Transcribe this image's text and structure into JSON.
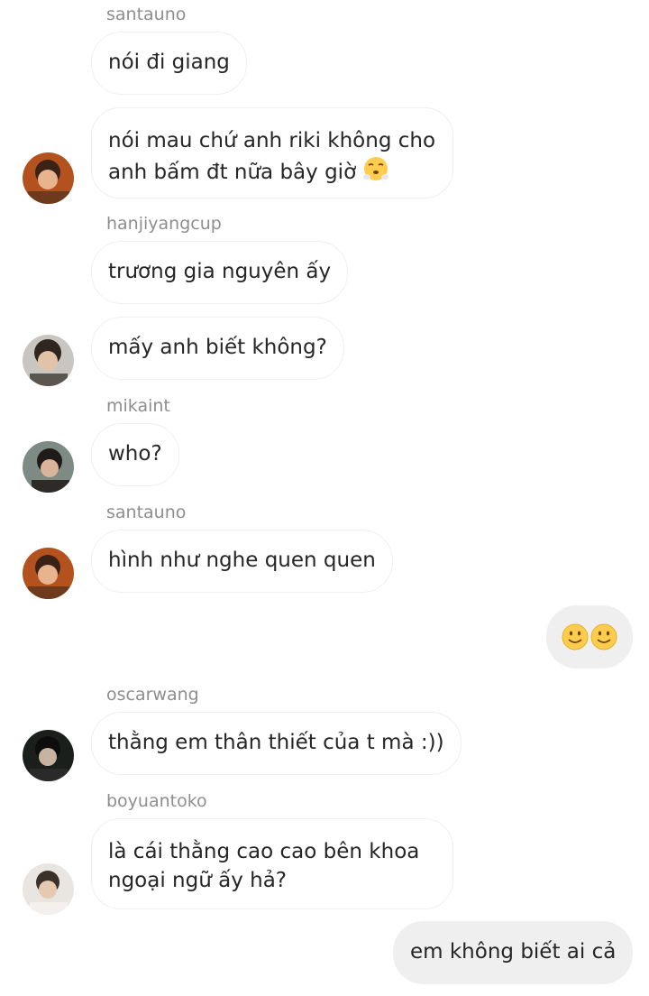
{
  "messages": [
    {
      "sender": "santauno",
      "text": "nói đi giang"
    },
    {
      "text": "nói mau chứ anh riki không cho anh bấm đt nữa bây giờ",
      "emoji": "steam-face-icon"
    },
    {
      "sender": "hanjiyangcup",
      "text": "trương gia nguyên ấy"
    },
    {
      "text": "mấy anh biết không?"
    },
    {
      "sender": "mikaint",
      "text": "who?"
    },
    {
      "sender": "santauno",
      "text": "hình như nghe quen quen"
    },
    {
      "self": true,
      "emoji": "slightly-smiling-face-icon x2"
    },
    {
      "sender": "oscarwang",
      "text": "thằng em thân thiết của t mà :))"
    },
    {
      "sender": "boyuantoko",
      "text": "là cái thằng cao cao bên khoa ngoại ngữ ấy hả?"
    },
    {
      "self": true,
      "text": "em không biết ai cả"
    }
  ],
  "colors": {
    "bubble_border": "#efefef",
    "self_bubble": "#efefef",
    "sender_name": "#8e8e8e",
    "text": "#262626"
  }
}
